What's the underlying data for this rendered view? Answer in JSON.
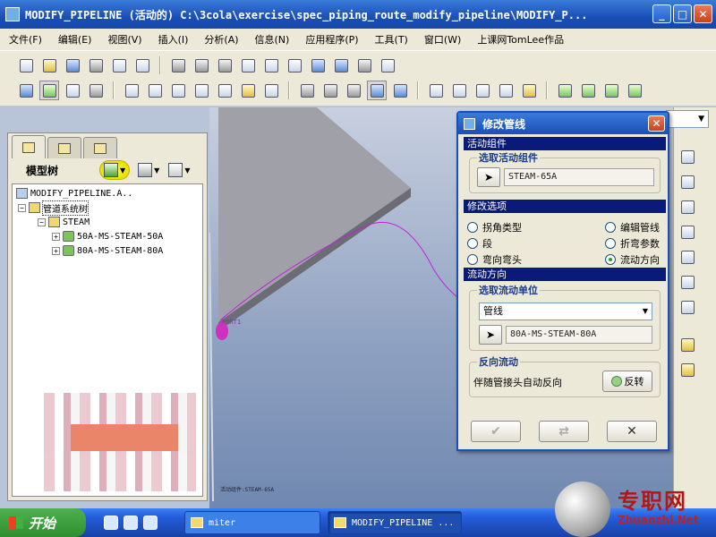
{
  "window": {
    "title": "MODIFY_PIPELINE (活动的) C:\\3cola\\exercise\\spec_piping_route_modify_pipeline\\MODIFY_P...",
    "min_label": "_",
    "max_label": "□",
    "close_label": "✕"
  },
  "menu": [
    "文件(F)",
    "编辑(E)",
    "视图(V)",
    "插入(I)",
    "分析(A)",
    "信息(N)",
    "应用程序(P)",
    "工具(T)",
    "窗口(W)",
    "上课网TomLee作品"
  ],
  "model_tree": {
    "title": "模型树",
    "nodes": [
      {
        "label": "MODIFY_PIPELINE.A..",
        "expander": ""
      },
      {
        "label": "管道系统树",
        "expander": "−"
      },
      {
        "label": "STEAM",
        "expander": "−"
      },
      {
        "label": "50A-MS-STEAM-50A",
        "expander": "+"
      },
      {
        "label": "80A-MS-STEAM-80A",
        "expander": "+"
      }
    ]
  },
  "viewport": {
    "port_label": "PORT1",
    "status_small": "活动组件:STEAM-65A"
  },
  "dialog": {
    "title": "修改管线",
    "close_label": "✕",
    "section_active": "活动组件",
    "group_select_active": "选取活动组件",
    "active_component_value": "STEAM-65A",
    "section_options": "修改选项",
    "options": [
      {
        "label": "拐角类型",
        "selected": false
      },
      {
        "label": "编辑管线",
        "selected": false
      },
      {
        "label": "段",
        "selected": false
      },
      {
        "label": "折弯参数",
        "selected": false
      },
      {
        "label": "弯向弯头",
        "selected": false
      },
      {
        "label": "流动方向",
        "selected": true
      }
    ],
    "section_flow": "流动方向",
    "group_select_flow": "选取流动单位",
    "flow_unit_combo": "管线",
    "flow_unit_value": "80A-MS-STEAM-80A",
    "group_reverse": "反向流动",
    "reverse_desc": "伴随管接头自动反向",
    "reverse_button": "反转",
    "ok_label": "✔",
    "apply_label": "⇄",
    "cancel_label": "✕"
  },
  "taskbar": {
    "start_label": "开始",
    "tasks": [
      "miter",
      "MODIFY_PIPELINE ..."
    ]
  },
  "watermark": {
    "text": "专职网",
    "url": "Zhuanzhi.Net"
  }
}
